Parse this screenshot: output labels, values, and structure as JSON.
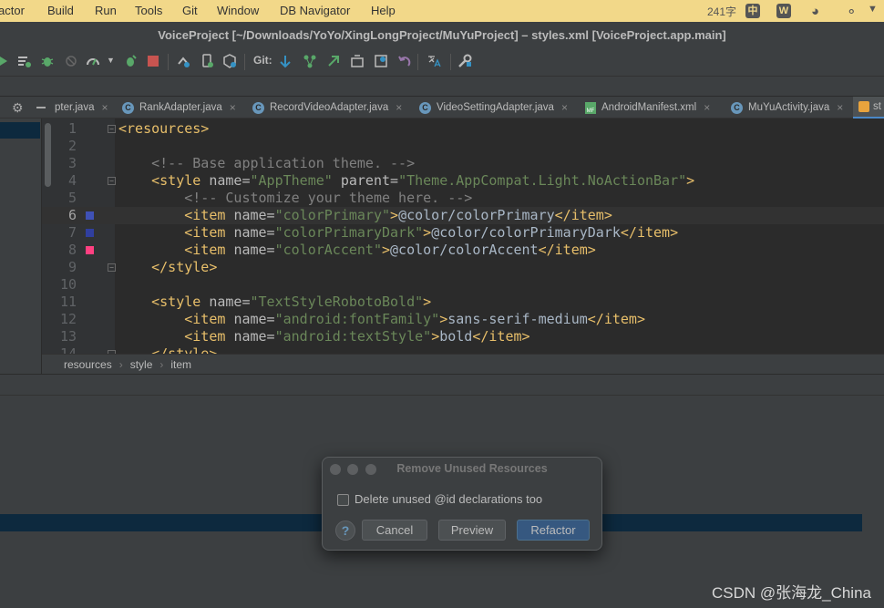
{
  "menubar": {
    "items": [
      "actor",
      "Build",
      "Run",
      "Tools",
      "Git",
      "Window",
      "DB Navigator",
      "Help"
    ],
    "right": {
      "word_count": "241字",
      "ime": "中"
    }
  },
  "window": {
    "title": "VoiceProject [~/Downloads/YoYo/XingLongProject/MuYuProject] – styles.xml [VoiceProject.app.main]"
  },
  "toolbar": {
    "git_label": "Git:"
  },
  "tabs": [
    {
      "label": "pter.java",
      "icon": "class-icon"
    },
    {
      "label": "RankAdapter.java",
      "icon": "class-icon"
    },
    {
      "label": "RecordVideoAdapter.java",
      "icon": "class-icon"
    },
    {
      "label": "VideoSettingAdapter.java",
      "icon": "class-icon"
    },
    {
      "label": "AndroidManifest.xml",
      "icon": "manifest-icon"
    },
    {
      "label": "MuYuActivity.java",
      "icon": "class-icon"
    },
    {
      "label": "st",
      "icon": "xml-icon"
    }
  ],
  "editor": {
    "lines": [
      {
        "n": "1",
        "indent": "",
        "parts": [
          [
            "t",
            "<resources>"
          ]
        ]
      },
      {
        "n": "2",
        "indent": "",
        "parts": []
      },
      {
        "n": "3",
        "indent": "    ",
        "parts": [
          [
            "c",
            "<!-- Base application theme. -->"
          ]
        ]
      },
      {
        "n": "4",
        "indent": "    ",
        "parts": [
          [
            "t",
            "<style "
          ],
          [
            "a",
            "name="
          ],
          [
            "s",
            "\"AppTheme\" "
          ],
          [
            "a",
            "parent="
          ],
          [
            "s",
            "\"Theme.AppCompat.Light.NoActionBar\""
          ],
          [
            "t",
            ">"
          ]
        ]
      },
      {
        "n": "5",
        "indent": "        ",
        "parts": [
          [
            "c",
            "<!-- Customize your theme here. -->"
          ]
        ]
      },
      {
        "n": "6",
        "indent": "        ",
        "parts": [
          [
            "t",
            "<item "
          ],
          [
            "a",
            "name="
          ],
          [
            "s",
            "\"colorPrimary\""
          ],
          [
            "t",
            ">"
          ],
          [
            "p",
            "@color/colorPrimary"
          ],
          [
            "t",
            "</item>"
          ]
        ]
      },
      {
        "n": "7",
        "indent": "        ",
        "parts": [
          [
            "t",
            "<item "
          ],
          [
            "a",
            "name="
          ],
          [
            "s",
            "\"colorPrimaryDark\""
          ],
          [
            "t",
            ">"
          ],
          [
            "p",
            "@color/colorPrimaryDark"
          ],
          [
            "t",
            "</item>"
          ]
        ]
      },
      {
        "n": "8",
        "indent": "        ",
        "parts": [
          [
            "t",
            "<item "
          ],
          [
            "a",
            "name="
          ],
          [
            "s",
            "\"colorAccent\""
          ],
          [
            "t",
            ">"
          ],
          [
            "p",
            "@color/colorAccent"
          ],
          [
            "t",
            "</item>"
          ]
        ]
      },
      {
        "n": "9",
        "indent": "    ",
        "parts": [
          [
            "t",
            "</style>"
          ]
        ]
      },
      {
        "n": "10",
        "indent": "",
        "parts": []
      },
      {
        "n": "11",
        "indent": "    ",
        "parts": [
          [
            "t",
            "<style "
          ],
          [
            "a",
            "name="
          ],
          [
            "s",
            "\"TextStyleRobotoBold\""
          ],
          [
            "t",
            ">"
          ]
        ]
      },
      {
        "n": "12",
        "indent": "        ",
        "parts": [
          [
            "t",
            "<item "
          ],
          [
            "a",
            "name="
          ],
          [
            "s",
            "\"android:fontFamily\""
          ],
          [
            "t",
            ">"
          ],
          [
            "p",
            "sans-serif-medium"
          ],
          [
            "t",
            "</item>"
          ]
        ]
      },
      {
        "n": "13",
        "indent": "        ",
        "parts": [
          [
            "t",
            "<item "
          ],
          [
            "a",
            "name="
          ],
          [
            "s",
            "\"android:textStyle\""
          ],
          [
            "t",
            ">"
          ],
          [
            "p",
            "bold"
          ],
          [
            "t",
            "</item>"
          ]
        ]
      },
      {
        "n": "14",
        "indent": "    ",
        "parts": [
          [
            "t",
            "</style>"
          ]
        ]
      }
    ],
    "current_line": "6",
    "color_markers": {
      "6": "#3f51b5",
      "7": "#303f9f",
      "8": "#ff4081"
    }
  },
  "breadcrumb": {
    "items": [
      "resources",
      "style",
      "item"
    ]
  },
  "dialog": {
    "title": "Remove Unused Resources",
    "checkbox_label": "Delete unused @id declarations too",
    "checkbox_checked": false,
    "help_glyph": "?",
    "buttons": {
      "cancel": "Cancel",
      "preview": "Preview",
      "refactor": "Refactor"
    }
  },
  "watermark": "CSDN @张海龙_China",
  "colors": {
    "accent": "#365880",
    "selection": "#0d293e",
    "tag": "#e8bf6a",
    "string": "#6a8759",
    "comment": "#808080"
  }
}
